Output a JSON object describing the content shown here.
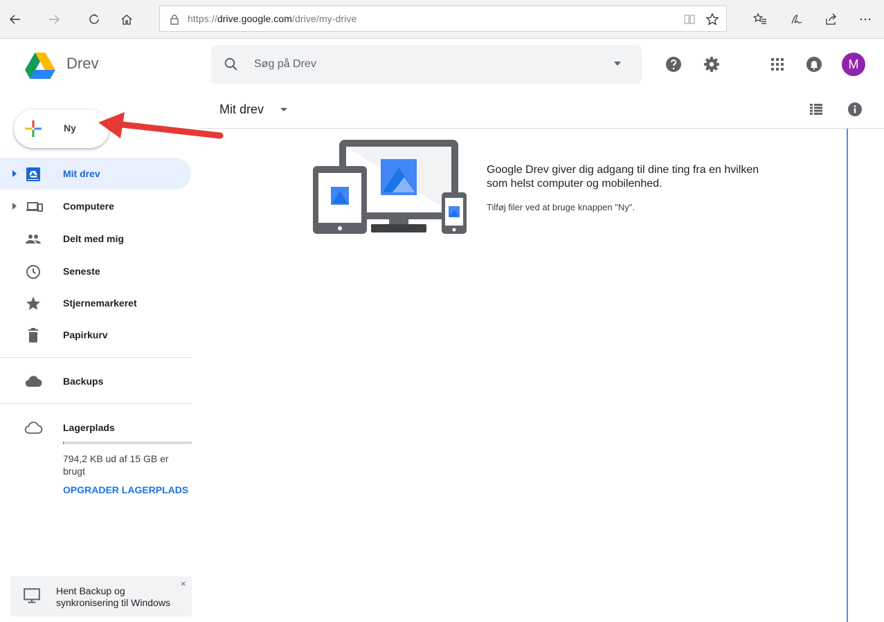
{
  "browser": {
    "url_prefix": "https://",
    "url_host": "drive.google.com",
    "url_path": "/drive/my-drive"
  },
  "app": {
    "name": "Drev"
  },
  "search": {
    "placeholder": "Søg på Drev"
  },
  "user": {
    "avatar_initial": "M",
    "avatar_color": "#8e24aa"
  },
  "new_button": {
    "label": "Ny"
  },
  "sidebar": {
    "items": [
      {
        "label": "Mit drev",
        "icon": "my-drive-icon"
      },
      {
        "label": "Computere",
        "icon": "computers-icon"
      },
      {
        "label": "Delt med mig",
        "icon": "people-icon"
      },
      {
        "label": "Seneste",
        "icon": "clock-icon"
      },
      {
        "label": "Stjernemarkeret",
        "icon": "star-icon"
      },
      {
        "label": "Papirkurv",
        "icon": "trash-icon"
      },
      {
        "label": "Backups",
        "icon": "cloud-icon"
      },
      {
        "label": "Lagerplads",
        "icon": "cloud-outline-icon"
      }
    ],
    "storage_text": "794,2 KB ud af 15 GB er brugt",
    "storage_used_fraction": 0.0001,
    "upgrade_label": "OPGRADER LAGERPLADS"
  },
  "promo": {
    "text_line1": "Hent Backup og",
    "text_line2": "synkronisering til Windows",
    "close": "×"
  },
  "main": {
    "title": "Mit drev",
    "empty_title": "Google Drev giver dig adgang til dine ting fra en hvilken som helst computer og mobilenhed.",
    "empty_sub": "Tilføj filer ved at bruge knappen \"Ny\"."
  },
  "colors": {
    "accent": "#1a73e8",
    "active_bg": "#e8f0fe",
    "annotation_arrow": "#e53935"
  }
}
